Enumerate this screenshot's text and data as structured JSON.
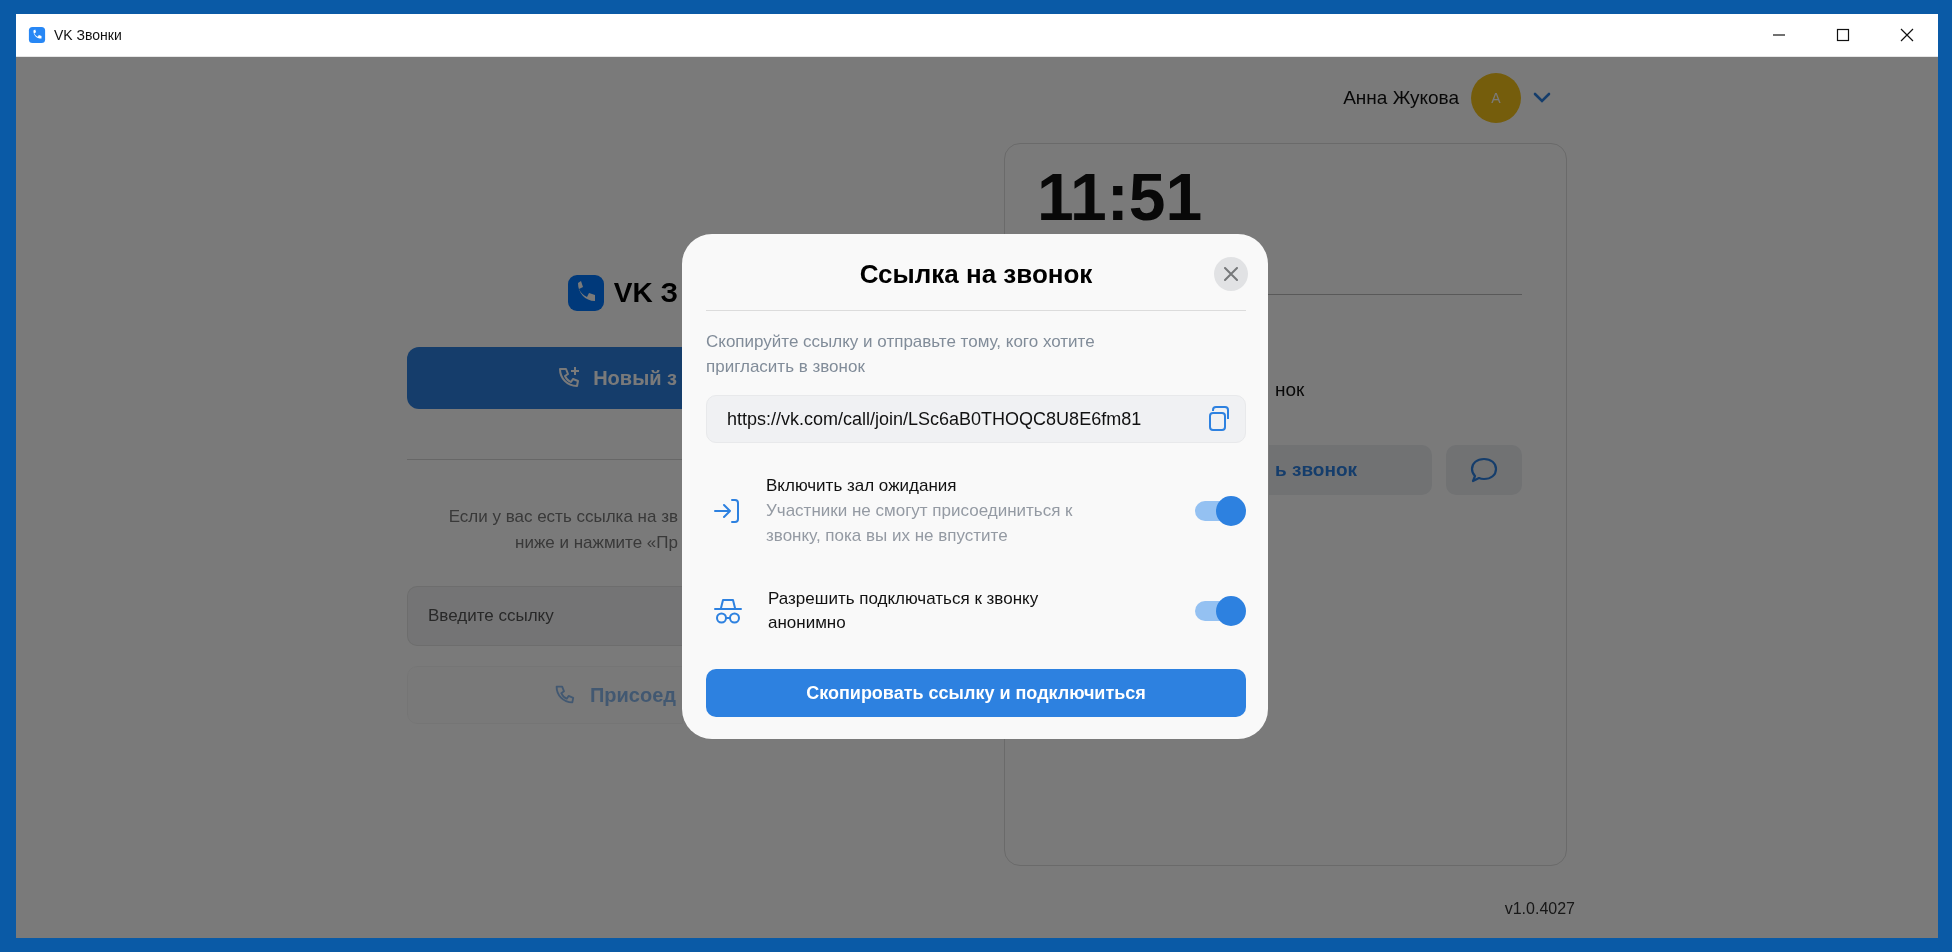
{
  "window": {
    "title": "VK Звонки"
  },
  "header": {
    "user_name": "Анна Жукова",
    "avatar_initial": "А"
  },
  "left_panel": {
    "logo_text": "VK З",
    "new_call_button": "Новый з",
    "hint_lines": [
      "Если у вас есть ссылка на зв",
      "ниже и нажмите «Пр"
    ],
    "link_input": {
      "placeholder": "Введите ссылку"
    },
    "join_button": "Присоед"
  },
  "right_panel": {
    "time": "11:51",
    "text": "нок",
    "start_button": "ь звонок"
  },
  "version": "v1.0.4027",
  "dialog": {
    "title": "Ссылка на звонок",
    "description": "Скопируйте ссылку и отправьте тому, кого хотите пригласить в звонок",
    "link": {
      "value": "https://vk.com/call/join/LSc6aB0THOQC8U8E6fm81"
    },
    "options": [
      {
        "kind": "waiting-room",
        "title": "Включить зал ожидания",
        "description": "Участники не смогут присоединиться к звонку, пока вы их не впустите",
        "on": true
      },
      {
        "kind": "anonymous",
        "title": "Разрешить подключаться к звонку анонимно",
        "on": true
      }
    ],
    "primary_button": "Скопировать ссылку и подключиться"
  }
}
